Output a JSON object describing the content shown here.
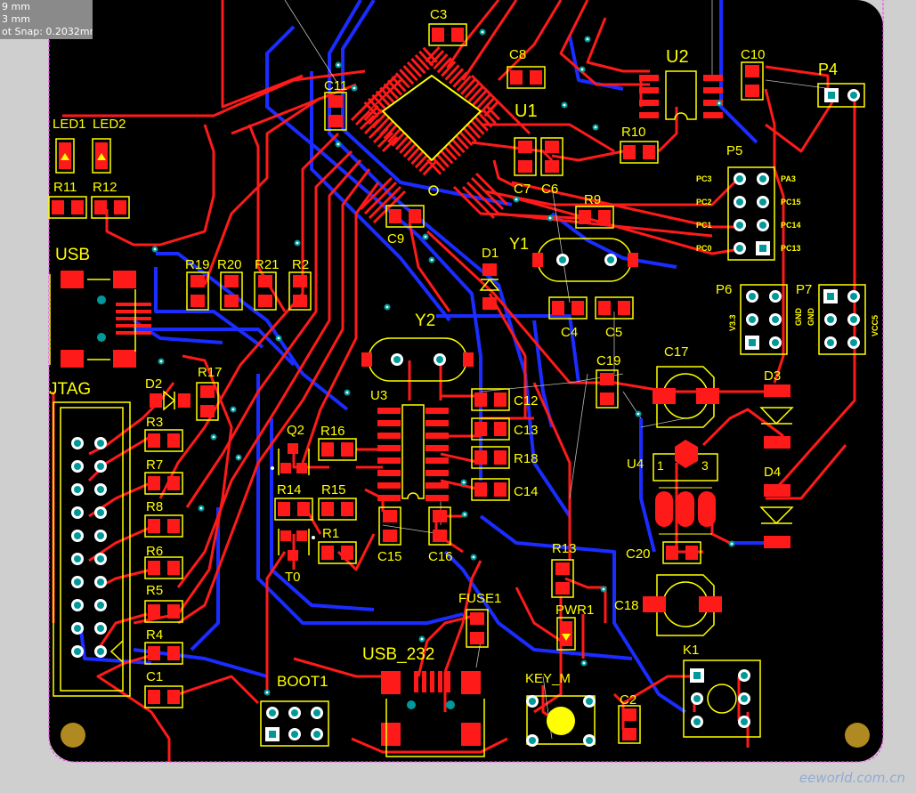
{
  "readout": {
    "line1": "9 mm",
    "line2": "3 mm",
    "line3": "ot Snap: 0.2032mm"
  },
  "watermark": "eeworld.com.cn",
  "colors": {
    "board": "#000000",
    "top_copper": "#ff1a1a",
    "bottom_copper": "#1a2cff",
    "silkscreen": "#ffff00",
    "outline": "#ff40ff",
    "via": "#009999",
    "mount_hole": "#b08a20"
  },
  "components": [
    {
      "ref": "C3",
      "label": "C3"
    },
    {
      "ref": "C8",
      "label": "C8"
    },
    {
      "ref": "U2",
      "label": "U2"
    },
    {
      "ref": "C10",
      "label": "C10"
    },
    {
      "ref": "P4",
      "label": "P4"
    },
    {
      "ref": "C11",
      "label": "C11"
    },
    {
      "ref": "U1",
      "label": "U1"
    },
    {
      "ref": "R10",
      "label": "R10"
    },
    {
      "ref": "LED1",
      "label": "LED1"
    },
    {
      "ref": "LED2",
      "label": "LED2"
    },
    {
      "ref": "P5",
      "label": "P5"
    },
    {
      "ref": "R11",
      "label": "R11"
    },
    {
      "ref": "R12",
      "label": "R12"
    },
    {
      "ref": "C7",
      "label": "C7"
    },
    {
      "ref": "C6",
      "label": "C6"
    },
    {
      "ref": "R9",
      "label": "R9"
    },
    {
      "ref": "C9",
      "label": "C9"
    },
    {
      "ref": "Y1",
      "label": "Y1"
    },
    {
      "ref": "USB",
      "label": "USB"
    },
    {
      "ref": "D1",
      "label": "D1"
    },
    {
      "ref": "R19",
      "label": "R19"
    },
    {
      "ref": "R20",
      "label": "R20"
    },
    {
      "ref": "R21",
      "label": "R21"
    },
    {
      "ref": "R2",
      "label": "R2"
    },
    {
      "ref": "P6",
      "label": "P6"
    },
    {
      "ref": "P7",
      "label": "P7"
    },
    {
      "ref": "C4",
      "label": "C4"
    },
    {
      "ref": "C5",
      "label": "C5"
    },
    {
      "ref": "Y2",
      "label": "Y2"
    },
    {
      "ref": "C17",
      "label": "C17"
    },
    {
      "ref": "C19",
      "label": "C19"
    },
    {
      "ref": "JTAG",
      "label": "JTAG"
    },
    {
      "ref": "D2",
      "label": "D2"
    },
    {
      "ref": "R17",
      "label": "R17"
    },
    {
      "ref": "U3",
      "label": "U3"
    },
    {
      "ref": "C12",
      "label": "C12"
    },
    {
      "ref": "D3",
      "label": "D3"
    },
    {
      "ref": "R3",
      "label": "R3"
    },
    {
      "ref": "C13",
      "label": "C13"
    },
    {
      "ref": "Q2",
      "label": "Q2"
    },
    {
      "ref": "R16",
      "label": "R16"
    },
    {
      "ref": "R18",
      "label": "R18"
    },
    {
      "ref": "U4",
      "label": "U4"
    },
    {
      "ref": "R7",
      "label": "R7"
    },
    {
      "ref": "R14",
      "label": "R14"
    },
    {
      "ref": "R15",
      "label": "R15"
    },
    {
      "ref": "C14",
      "label": "C14"
    },
    {
      "ref": "D4",
      "label": "D4"
    },
    {
      "ref": "R8",
      "label": "R8"
    },
    {
      "ref": "R1",
      "label": "R1"
    },
    {
      "ref": "R6",
      "label": "R6"
    },
    {
      "ref": "C15",
      "label": "C15"
    },
    {
      "ref": "C16",
      "label": "C16"
    },
    {
      "ref": "R13",
      "label": "R13"
    },
    {
      "ref": "C20",
      "label": "C20"
    },
    {
      "ref": "R5",
      "label": "R5"
    },
    {
      "ref": "T0",
      "label": "T0"
    },
    {
      "ref": "C18",
      "label": "C18"
    },
    {
      "ref": "FUSE1",
      "label": "FUSE1"
    },
    {
      "ref": "PWR1",
      "label": "PWR1"
    },
    {
      "ref": "R4",
      "label": "R4"
    },
    {
      "ref": "USB_232",
      "label": "USB_232"
    },
    {
      "ref": "K1",
      "label": "K1"
    },
    {
      "ref": "C1",
      "label": "C1"
    },
    {
      "ref": "BOOT1",
      "label": "BOOT1"
    },
    {
      "ref": "KEY_M",
      "label": "KEY_M"
    },
    {
      "ref": "C2",
      "label": "C2"
    }
  ],
  "pin_labels": {
    "p5_left": [
      "PC3",
      "PC2",
      "PC1",
      "PC0"
    ],
    "p5_right": [
      "PA3",
      "PC15",
      "PC14",
      "PC13"
    ],
    "p6": "V3.3",
    "p7_gnd1": "GND",
    "p7_gnd2": "GND",
    "p7_vcc": "VCC5",
    "u4_pin1": "1",
    "u4_pin3": "3"
  }
}
